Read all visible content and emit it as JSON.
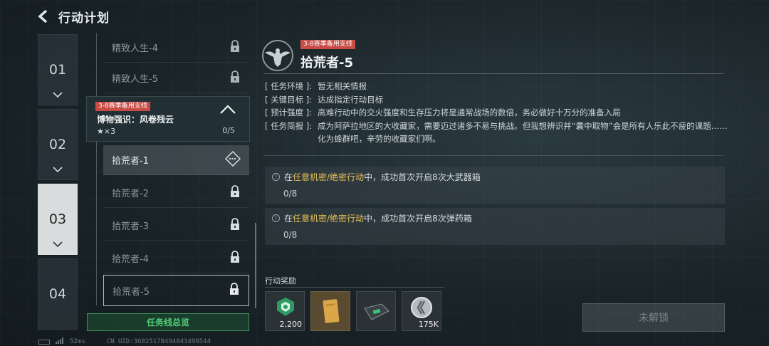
{
  "header": {
    "title": "行动计划"
  },
  "chapters": [
    {
      "label": "01",
      "active": false
    },
    {
      "label": "02",
      "active": false
    },
    {
      "label": "03",
      "active": true
    },
    {
      "label": "04",
      "active": false
    }
  ],
  "mission_list": {
    "top_items": [
      {
        "name": "精致人生-4"
      },
      {
        "name": "精致人生-5"
      }
    ],
    "group": {
      "badge": "3-8赛季备用支线",
      "name": "博物强识：风卷残云",
      "stars": "★×3",
      "progress": "0/5"
    },
    "sub_items": [
      {
        "name": "拾荒者-1"
      },
      {
        "name": "拾荒者-2"
      },
      {
        "name": "拾荒者-3"
      },
      {
        "name": "拾荒者-4"
      },
      {
        "name": "拾荒者-5"
      }
    ],
    "overview_label": "任务线总览"
  },
  "detail": {
    "badge": "3-8赛季备用支线",
    "title": "拾荒者-5",
    "info": [
      {
        "key": "[ 任务环境 ]:",
        "value": "暂无相关情报"
      },
      {
        "key": "[ 关键目标 ]:",
        "value": "达成指定行动目标"
      },
      {
        "key": "[ 预计强度 ]:",
        "value": "高难行动中的交火强度和生存压力将是通常战场的数倍，务必做好十万分的准备入局"
      },
      {
        "key": "[ 任务简报 ]:",
        "value": "成为阿萨拉地区的大收藏家，需要迈过诸多不易与挑战。但我想辨识并“囊中取物”会是所有人乐此不疲的课题……化为蜂群吧，辛劳的收藏家们啊。"
      }
    ],
    "tasks": [
      {
        "prefix": "在",
        "highlight": "任意机密/绝密行动",
        "suffix": "中，成功首次开启8次大武器箱",
        "count": "0/8"
      },
      {
        "prefix": "在",
        "highlight": "任意机密/绝密行动",
        "suffix": "中，成功首次开启8次弹药箱",
        "count": "0/8"
      }
    ],
    "rewards_label": "行动奖励",
    "rewards": [
      {
        "icon": "green-badge-icon",
        "qty": "2,200"
      },
      {
        "icon": "gold-card-icon",
        "qty": ""
      },
      {
        "icon": "device-case-icon",
        "qty": ""
      },
      {
        "icon": "silver-coin-icon",
        "qty": "175K"
      }
    ],
    "locked_button": "未解锁"
  },
  "footer": {
    "ping": "52ms",
    "uid": "CN UID:36825178494843499544"
  },
  "colors": {
    "badge_red": "#c94b45",
    "highlight_gold": "#e8c154",
    "overview_green": "#53d17c"
  }
}
